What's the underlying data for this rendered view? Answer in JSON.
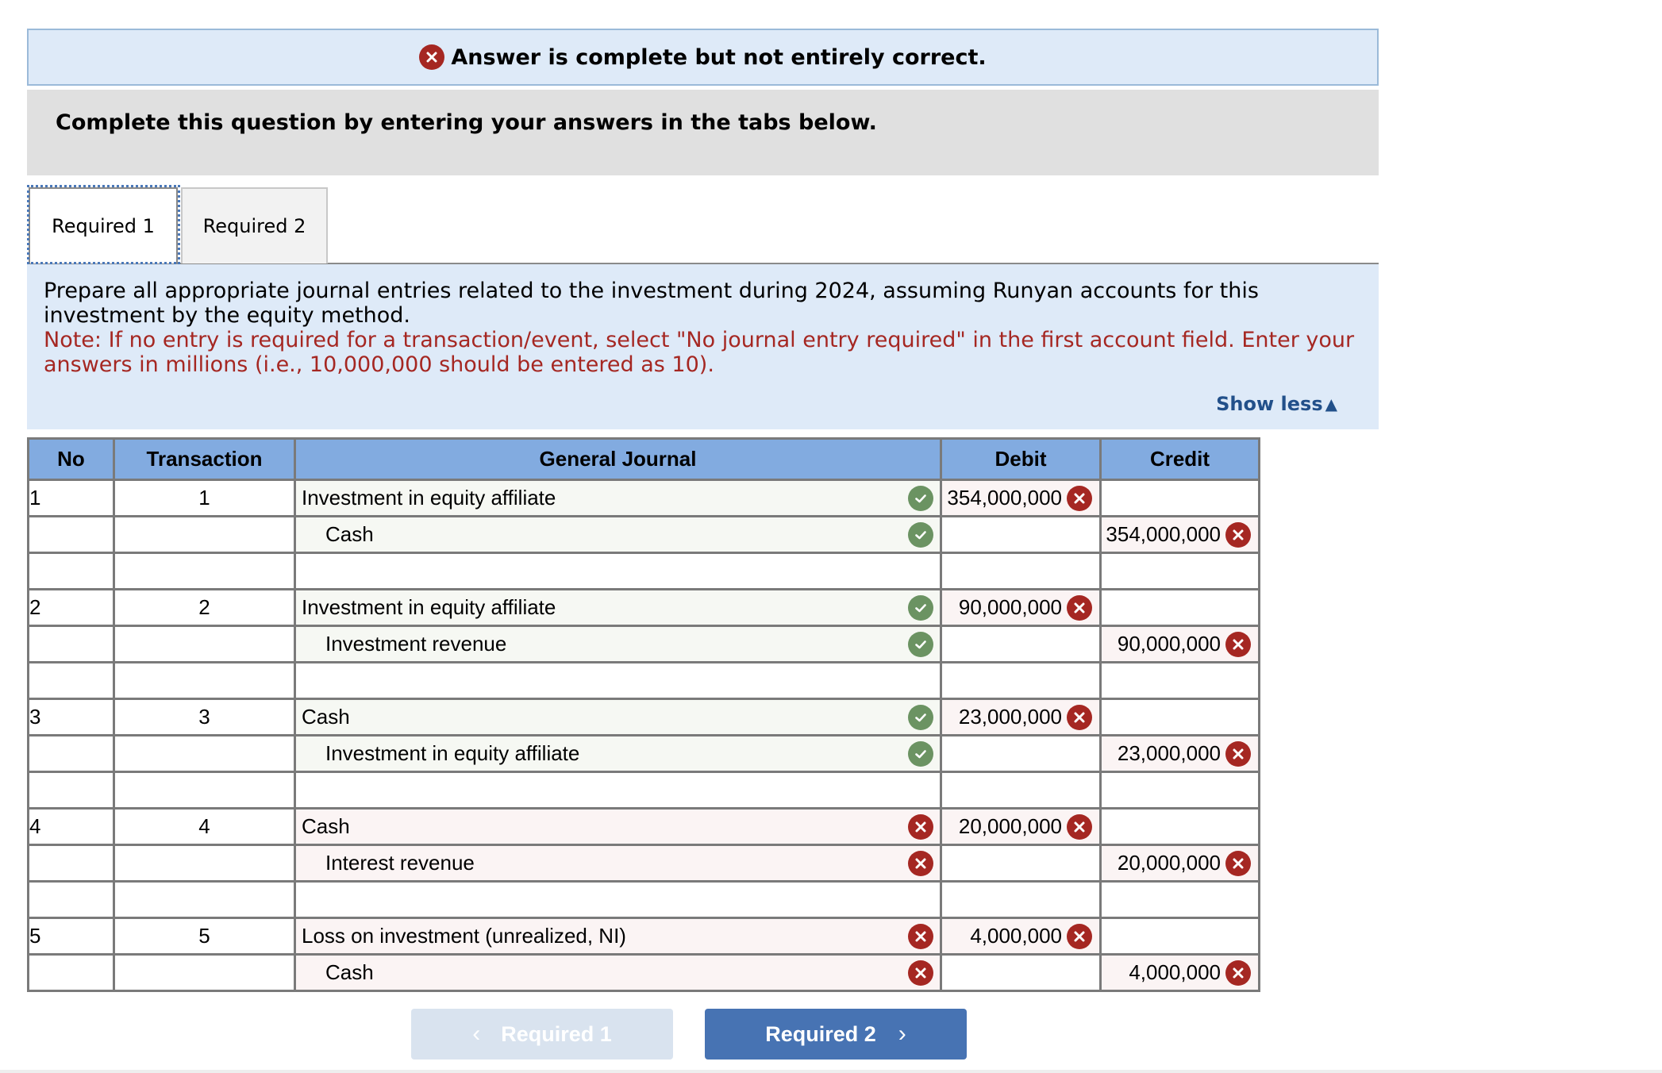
{
  "banner": {
    "status_icon": "x-circle-icon",
    "message": "Answer is complete but not entirely correct."
  },
  "instruction": "Complete this question by entering your answers in the tabs below.",
  "tabs": [
    {
      "label": "Required 1",
      "active": true
    },
    {
      "label": "Required 2",
      "active": false
    }
  ],
  "question": {
    "prompt": "Prepare all appropriate journal entries related to the investment during 2024, assuming Runyan accounts for this investment by the equity method.",
    "note": "Note: If no entry is required for a transaction/event, select \"No journal entry required\" in the first account field. Enter your answers in millions (i.e., 10,000,000 should be entered as 10).",
    "show_less_label": "Show less",
    "show_less_icon": "triangle-up-icon"
  },
  "table": {
    "headers": {
      "no": "No",
      "transaction": "Transaction",
      "general_journal": "General Journal",
      "debit": "Debit",
      "credit": "Credit"
    },
    "rows": [
      {
        "no": "1",
        "transaction": "1",
        "account": "Investment in equity affiliate",
        "indent": false,
        "account_status": "correct",
        "debit": "354,000,000",
        "debit_status": "incorrect",
        "credit": "",
        "credit_status": ""
      },
      {
        "no": "",
        "transaction": "",
        "account": "Cash",
        "indent": true,
        "account_status": "correct",
        "debit": "",
        "debit_status": "",
        "credit": "354,000,000",
        "credit_status": "incorrect"
      },
      {
        "no": "",
        "transaction": "",
        "account": "",
        "indent": false,
        "account_status": "",
        "debit": "",
        "debit_status": "",
        "credit": "",
        "credit_status": ""
      },
      {
        "no": "2",
        "transaction": "2",
        "account": "Investment in equity affiliate",
        "indent": false,
        "account_status": "correct",
        "debit": "90,000,000",
        "debit_status": "incorrect",
        "credit": "",
        "credit_status": ""
      },
      {
        "no": "",
        "transaction": "",
        "account": "Investment revenue",
        "indent": true,
        "account_status": "correct",
        "debit": "",
        "debit_status": "",
        "credit": "90,000,000",
        "credit_status": "incorrect"
      },
      {
        "no": "",
        "transaction": "",
        "account": "",
        "indent": false,
        "account_status": "",
        "debit": "",
        "debit_status": "",
        "credit": "",
        "credit_status": ""
      },
      {
        "no": "3",
        "transaction": "3",
        "account": "Cash",
        "indent": false,
        "account_status": "correct",
        "debit": "23,000,000",
        "debit_status": "incorrect",
        "credit": "",
        "credit_status": ""
      },
      {
        "no": "",
        "transaction": "",
        "account": "Investment in equity affiliate",
        "indent": true,
        "account_status": "correct",
        "debit": "",
        "debit_status": "",
        "credit": "23,000,000",
        "credit_status": "incorrect"
      },
      {
        "no": "",
        "transaction": "",
        "account": "",
        "indent": false,
        "account_status": "",
        "debit": "",
        "debit_status": "",
        "credit": "",
        "credit_status": ""
      },
      {
        "no": "4",
        "transaction": "4",
        "account": "Cash",
        "indent": false,
        "account_status": "incorrect",
        "debit": "20,000,000",
        "debit_status": "incorrect",
        "credit": "",
        "credit_status": ""
      },
      {
        "no": "",
        "transaction": "",
        "account": "Interest revenue",
        "indent": true,
        "account_status": "incorrect",
        "debit": "",
        "debit_status": "",
        "credit": "20,000,000",
        "credit_status": "incorrect"
      },
      {
        "no": "",
        "transaction": "",
        "account": "",
        "indent": false,
        "account_status": "",
        "debit": "",
        "debit_status": "",
        "credit": "",
        "credit_status": ""
      },
      {
        "no": "5",
        "transaction": "5",
        "account": "Loss on investment (unrealized, NI)",
        "indent": false,
        "account_status": "incorrect",
        "debit": "4,000,000",
        "debit_status": "incorrect",
        "credit": "",
        "credit_status": ""
      },
      {
        "no": "",
        "transaction": "",
        "account": "Cash",
        "indent": true,
        "account_status": "incorrect",
        "debit": "",
        "debit_status": "",
        "credit": "4,000,000",
        "credit_status": "incorrect"
      }
    ]
  },
  "navigation": {
    "prev_label": "Required 1",
    "prev_enabled": false,
    "next_label": "Required 2",
    "next_enabled": true
  },
  "colors": {
    "correct": "#6b9362",
    "incorrect": "#a52722",
    "header_blue": "#82abe0",
    "panel_blue": "#deeaf8",
    "button_blue": "#4773b3"
  }
}
